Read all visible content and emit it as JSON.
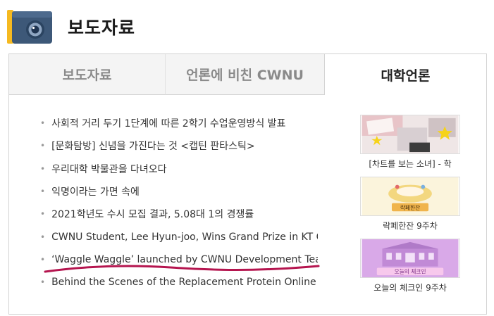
{
  "header": {
    "title": "보도자료",
    "icon": "camera-icon"
  },
  "tabs": [
    {
      "label": "보도자료",
      "active": false
    },
    {
      "label": "언론에 비친 CWNU",
      "active": false
    },
    {
      "label": "대학언론",
      "active": true
    }
  ],
  "news": [
    "사회적 거리 두기 1단계에 따른 2학기 수업운영방식 발표",
    "[문화탐방] 신념을 가진다는 것 <캡틴 판타스틱>",
    "우리대학 박물관을 다녀오다",
    "익명이라는 가면 속에",
    "2021학년도 수시 모집 결과, 5.08대 1의 경쟁률",
    "CWNU Student, Lee Hyun-joo, Wins Grand Prize in KT Contest",
    "‘Waggle Waggle’ launched by CWNU Development Team",
    "Behind the Scenes of the Replacement Protein Online System"
  ],
  "thumbs": [
    {
      "caption": "[차트를 보는 소녀] - 학",
      "image_text": ""
    },
    {
      "caption": "락페한잔 9주차",
      "image_text": "락페한잔"
    },
    {
      "caption": "오늘의 체크인 9주차",
      "image_text": "오늘의 체크인"
    }
  ],
  "colors": {
    "accent_yellow": "#f5b920",
    "icon_blue": "#3d5878",
    "active_tab_text": "#222222",
    "inactive_tab_bg": "#f4f4f4",
    "marker": "#b5154f"
  }
}
